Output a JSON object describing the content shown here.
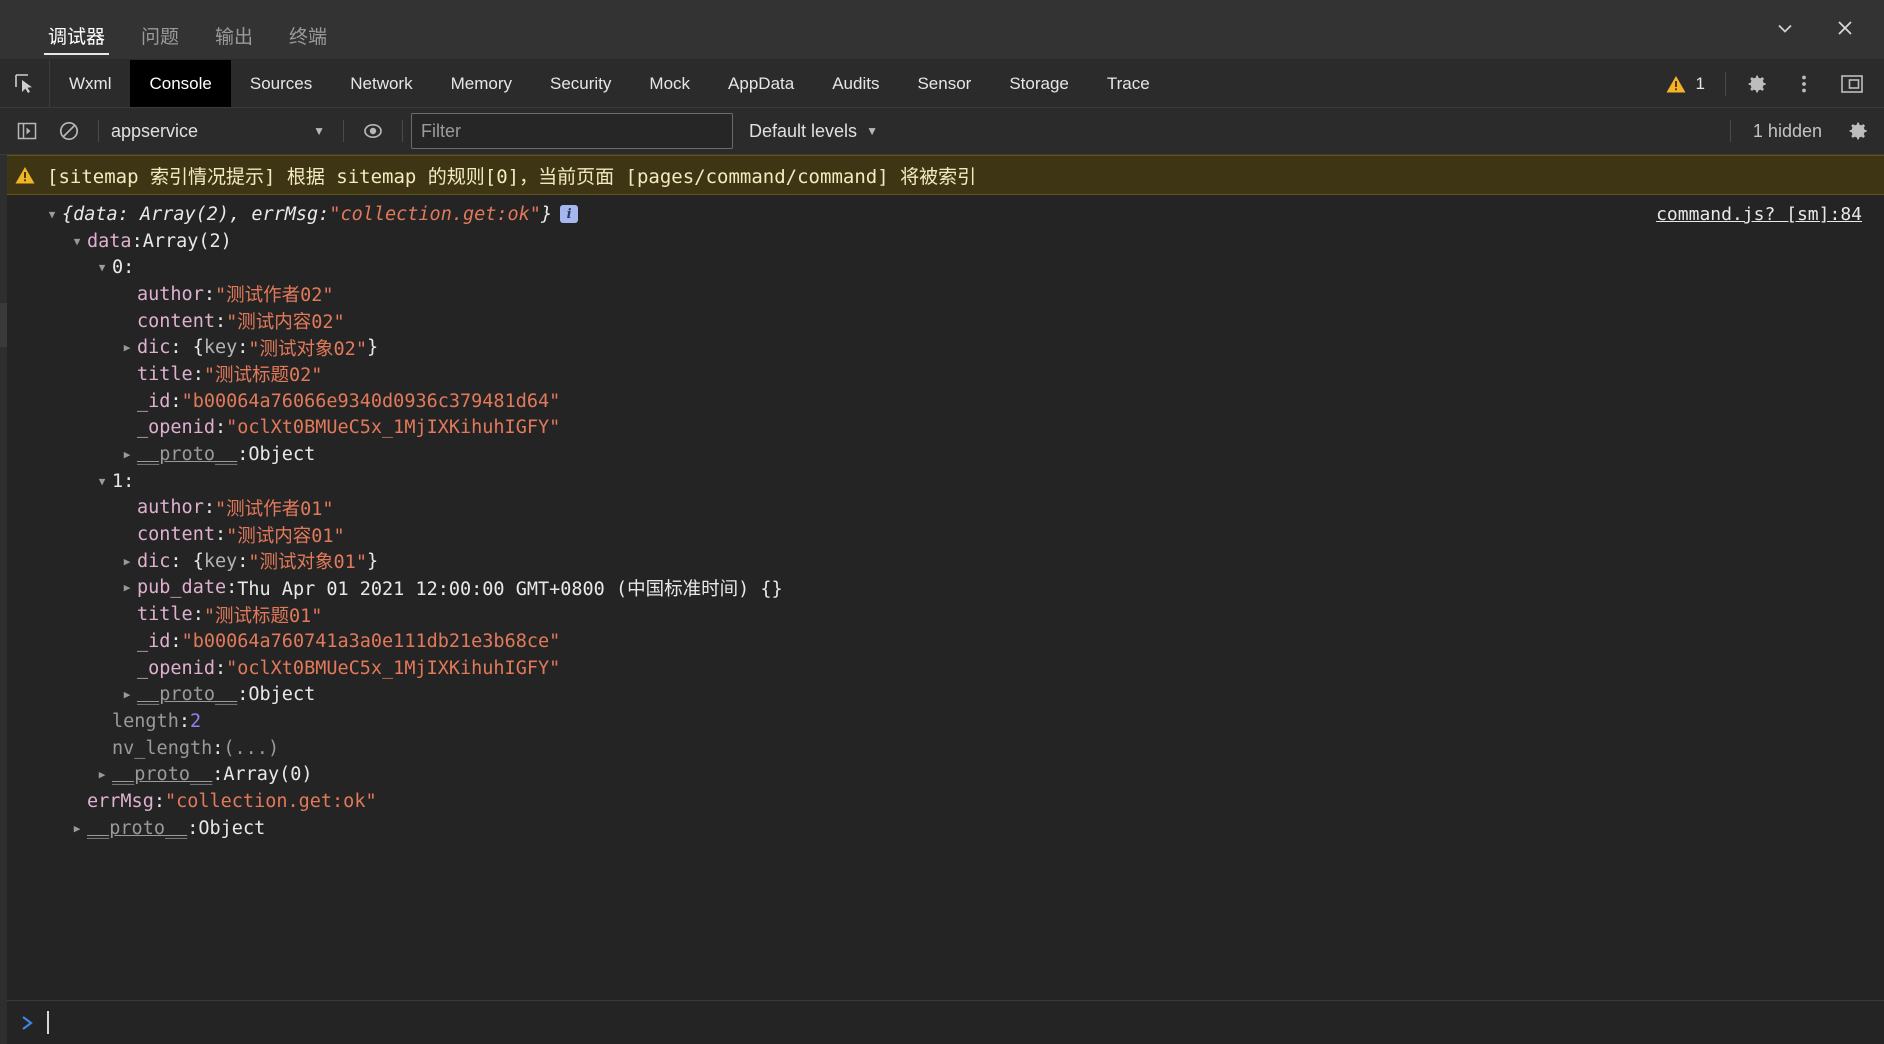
{
  "window": {
    "panel_tabs": [
      {
        "label": "调试器",
        "active": true
      },
      {
        "label": "问题",
        "active": false
      },
      {
        "label": "输出",
        "active": false
      },
      {
        "label": "终端",
        "active": false
      }
    ],
    "actions": [
      {
        "name": "chevron-down-icon",
        "label": "▾"
      },
      {
        "name": "close-icon",
        "label": "✕"
      }
    ]
  },
  "devtools": {
    "inspect_icon": "inspect-element-icon",
    "tabs": [
      {
        "label": "Wxml",
        "active": false
      },
      {
        "label": "Console",
        "active": true
      },
      {
        "label": "Sources",
        "active": false
      },
      {
        "label": "Network",
        "active": false
      },
      {
        "label": "Memory",
        "active": false
      },
      {
        "label": "Security",
        "active": false
      },
      {
        "label": "Mock",
        "active": false
      },
      {
        "label": "AppData",
        "active": false
      },
      {
        "label": "Audits",
        "active": false
      },
      {
        "label": "Sensor",
        "active": false
      },
      {
        "label": "Storage",
        "active": false
      },
      {
        "label": "Trace",
        "active": false
      }
    ],
    "warning_count": "1",
    "settings_icon": "gear-icon",
    "more_icon": "kebab-menu-icon",
    "dock_icon": "dock-panel-icon"
  },
  "console_toolbar": {
    "sidebar_toggle_icon": "show-console-sidebar-icon",
    "clear_icon": "clear-console-icon",
    "context": "appservice",
    "context_caret": "▼",
    "eye_icon": "live-expression-icon",
    "filter_value": "",
    "filter_placeholder": "Filter",
    "levels": "Default levels",
    "levels_caret": "▼",
    "hidden_text": "1 hidden",
    "settings_icon": "console-settings-gear-icon"
  },
  "messages": {
    "warning": {
      "icon": "warning-triangle-icon",
      "text": "[sitemap 索引情况提示] 根据 sitemap 的规则[0]，当前页面 [pages/command/command] 将被索引"
    },
    "log_source_link": "command.js? [sm]:84",
    "info_badge": "i",
    "tree": [
      {
        "indent": 0,
        "arrow": "down",
        "segments": [
          {
            "t": "{data: Array(2), errMsg: ",
            "c": "plain"
          },
          {
            "t": "\"collection.get:ok\"",
            "c": "str"
          },
          {
            "t": "}",
            "c": "plain"
          }
        ],
        "italic": true,
        "badge": true
      },
      {
        "indent": 1,
        "arrow": "down",
        "segments": [
          {
            "t": "data",
            "c": "prop"
          },
          {
            "t": ": ",
            "c": "plain"
          },
          {
            "t": "Array(2)",
            "c": "plain"
          }
        ]
      },
      {
        "indent": 2,
        "arrow": "down",
        "segments": [
          {
            "t": "0",
            "c": "plain"
          },
          {
            "t": ":",
            "c": "plain"
          }
        ]
      },
      {
        "indent": 3,
        "arrow": "none",
        "segments": [
          {
            "t": "author",
            "c": "prop"
          },
          {
            "t": ": ",
            "c": "plain"
          },
          {
            "t": "\"测试作者02\"",
            "c": "str"
          }
        ]
      },
      {
        "indent": 3,
        "arrow": "none",
        "segments": [
          {
            "t": "content",
            "c": "prop"
          },
          {
            "t": ": ",
            "c": "plain"
          },
          {
            "t": "\"测试内容02\"",
            "c": "str"
          }
        ]
      },
      {
        "indent": 3,
        "arrow": "right",
        "segments": [
          {
            "t": "dic",
            "c": "prop"
          },
          {
            "t": ": {",
            "c": "plain"
          },
          {
            "t": "key",
            "c": "dim"
          },
          {
            "t": ": ",
            "c": "plain"
          },
          {
            "t": "\"测试对象02\"",
            "c": "str"
          },
          {
            "t": "}",
            "c": "plain"
          }
        ]
      },
      {
        "indent": 3,
        "arrow": "none",
        "segments": [
          {
            "t": "title",
            "c": "prop"
          },
          {
            "t": ": ",
            "c": "plain"
          },
          {
            "t": "\"测试标题02\"",
            "c": "str"
          }
        ]
      },
      {
        "indent": 3,
        "arrow": "none",
        "segments": [
          {
            "t": "_id",
            "c": "prop"
          },
          {
            "t": ": ",
            "c": "plain"
          },
          {
            "t": "\"b00064a76066e9340d0936c379481d64\"",
            "c": "str"
          }
        ]
      },
      {
        "indent": 3,
        "arrow": "none",
        "segments": [
          {
            "t": "_openid",
            "c": "prop"
          },
          {
            "t": ": ",
            "c": "plain"
          },
          {
            "t": "\"oclXt0BMUeC5x_1MjIXKihuhIGFY\"",
            "c": "str"
          }
        ]
      },
      {
        "indent": 3,
        "arrow": "right",
        "segments": [
          {
            "t": "__proto__",
            "c": "proto"
          },
          {
            "t": ": ",
            "c": "plain"
          },
          {
            "t": "Object",
            "c": "plain"
          }
        ]
      },
      {
        "indent": 2,
        "arrow": "down",
        "segments": [
          {
            "t": "1",
            "c": "plain"
          },
          {
            "t": ":",
            "c": "plain"
          }
        ]
      },
      {
        "indent": 3,
        "arrow": "none",
        "segments": [
          {
            "t": "author",
            "c": "prop"
          },
          {
            "t": ": ",
            "c": "plain"
          },
          {
            "t": "\"测试作者01\"",
            "c": "str"
          }
        ]
      },
      {
        "indent": 3,
        "arrow": "none",
        "segments": [
          {
            "t": "content",
            "c": "prop"
          },
          {
            "t": ": ",
            "c": "plain"
          },
          {
            "t": "\"测试内容01\"",
            "c": "str"
          }
        ]
      },
      {
        "indent": 3,
        "arrow": "right",
        "segments": [
          {
            "t": "dic",
            "c": "prop"
          },
          {
            "t": ": {",
            "c": "plain"
          },
          {
            "t": "key",
            "c": "dim"
          },
          {
            "t": ": ",
            "c": "plain"
          },
          {
            "t": "\"测试对象01\"",
            "c": "str"
          },
          {
            "t": "}",
            "c": "plain"
          }
        ]
      },
      {
        "indent": 3,
        "arrow": "right",
        "segments": [
          {
            "t": "pub_date",
            "c": "prop"
          },
          {
            "t": ": ",
            "c": "plain"
          },
          {
            "t": "Thu Apr 01 2021 12:00:00 GMT+0800 (中国标准时间) {}",
            "c": "plain"
          }
        ]
      },
      {
        "indent": 3,
        "arrow": "none",
        "segments": [
          {
            "t": "title",
            "c": "prop"
          },
          {
            "t": ": ",
            "c": "plain"
          },
          {
            "t": "\"测试标题01\"",
            "c": "str"
          }
        ]
      },
      {
        "indent": 3,
        "arrow": "none",
        "segments": [
          {
            "t": "_id",
            "c": "prop"
          },
          {
            "t": ": ",
            "c": "plain"
          },
          {
            "t": "\"b00064a760741a3a0e111db21e3b68ce\"",
            "c": "str"
          }
        ]
      },
      {
        "indent": 3,
        "arrow": "none",
        "segments": [
          {
            "t": "_openid",
            "c": "prop"
          },
          {
            "t": ": ",
            "c": "plain"
          },
          {
            "t": "\"oclXt0BMUeC5x_1MjIXKihuhIGFY\"",
            "c": "str"
          }
        ]
      },
      {
        "indent": 3,
        "arrow": "right",
        "segments": [
          {
            "t": "__proto__",
            "c": "proto"
          },
          {
            "t": ": ",
            "c": "plain"
          },
          {
            "t": "Object",
            "c": "plain"
          }
        ]
      },
      {
        "indent": 2,
        "arrow": "none",
        "segments": [
          {
            "t": "length",
            "c": "gray"
          },
          {
            "t": ": ",
            "c": "plain"
          },
          {
            "t": "2",
            "c": "num"
          }
        ]
      },
      {
        "indent": 2,
        "arrow": "none",
        "segments": [
          {
            "t": "nv_length",
            "c": "gray"
          },
          {
            "t": ": ",
            "c": "plain"
          },
          {
            "t": "(...)",
            "c": "gray"
          }
        ]
      },
      {
        "indent": 2,
        "arrow": "right",
        "segments": [
          {
            "t": "__proto__",
            "c": "proto"
          },
          {
            "t": ": ",
            "c": "plain"
          },
          {
            "t": "Array(0)",
            "c": "plain"
          }
        ]
      },
      {
        "indent": 1,
        "arrow": "none",
        "segments": [
          {
            "t": "errMsg",
            "c": "prop"
          },
          {
            "t": ": ",
            "c": "plain"
          },
          {
            "t": "\"collection.get:ok\"",
            "c": "str"
          }
        ]
      },
      {
        "indent": 1,
        "arrow": "right",
        "segments": [
          {
            "t": "__proto__",
            "c": "proto"
          },
          {
            "t": ": ",
            "c": "plain"
          },
          {
            "t": "Object",
            "c": "plain"
          }
        ]
      }
    ]
  },
  "prompt": {
    "caret": "❯",
    "value": ""
  }
}
